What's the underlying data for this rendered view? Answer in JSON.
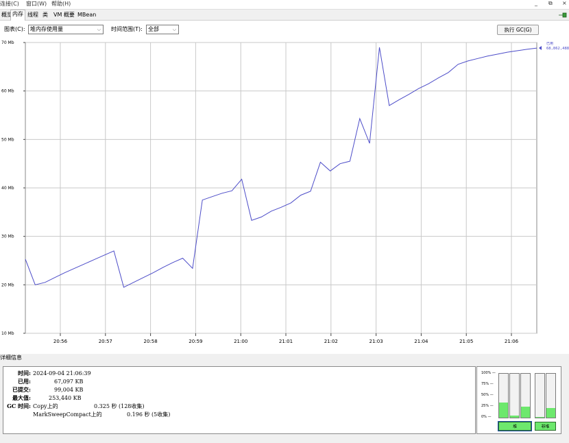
{
  "menubar": {
    "items": [
      "连接(C)",
      "窗口(W)",
      "帮助(H)"
    ]
  },
  "tabs": [
    "概览",
    "内存",
    "线程",
    "类",
    "VM 概要",
    "MBean"
  ],
  "toolbar": {
    "chart_label": "图表(C):",
    "chart_value": "堆内存使用量",
    "range_label": "时间范围(T):",
    "range_value": "全部",
    "gc_button": "执行 GC(G)"
  },
  "chart_data": {
    "type": "line",
    "x": [
      20.917,
      20.92,
      20.94,
      20.96,
      20.98,
      21.0,
      21.02,
      21.04,
      21.06,
      21.08,
      21.1,
      21.12,
      21.14,
      21.16,
      21.18,
      21.2,
      21.22,
      21.24,
      21.26,
      21.28,
      21.3,
      21.32,
      21.34,
      21.36,
      21.38,
      21.4,
      21.42,
      21.44,
      21.46,
      21.48,
      21.5,
      21.52,
      21.54,
      21.56,
      21.58,
      21.6,
      21.62,
      21.64,
      21.66,
      21.68,
      21.7,
      21.72,
      21.74,
      21.76,
      21.78,
      21.8,
      21.82,
      21.84,
      21.86,
      21.88,
      21.9,
      21.92,
      21.94,
      21.96,
      21.98,
      22.0,
      22.02,
      22.04,
      22.06,
      22.08,
      22.1,
      22.12,
      22.14,
      22.16,
      22.18,
      22.2,
      22.22,
      22.24,
      22.26,
      22.28,
      22.3,
      22.32,
      22.34,
      22.36,
      22.38,
      22.4,
      22.42,
      22.44,
      22.46,
      22.48,
      22.5,
      22.52,
      22.54,
      22.56,
      22.58,
      22.6,
      22.62,
      22.64,
      22.66,
      22.68,
      22.7,
      22.72,
      22.74,
      22.76,
      22.78,
      22.8,
      22.82,
      22.84,
      22.86,
      22.88,
      22.9,
      22.92,
      22.94,
      22.96,
      22.98,
      23.0,
      23.02,
      23.04,
      23.06,
      23.08,
      23.1
    ],
    "series": [
      {
        "name": "已用",
        "values": [
          25.3,
          20.0,
          20.5,
          21.5,
          22.5,
          23.4,
          24.3,
          25.2,
          26.1,
          27.0,
          19.5,
          20.5,
          21.5,
          22.5,
          23.6,
          24.6,
          25.5,
          23.4,
          37.5,
          38.2,
          38.9,
          39.4,
          41.8,
          33.3,
          34.0,
          35.2,
          36.0,
          36.9,
          38.5,
          39.3,
          45.3,
          43.5,
          45.0,
          45.5,
          54.3,
          49.2,
          69.0,
          57.0,
          58.2,
          59.3,
          60.5,
          61.5,
          62.7,
          63.8,
          65.5,
          66.2,
          66.7,
          67.2,
          67.6,
          68.0,
          68.3,
          68.6,
          68.86,
          68.86,
          68.86,
          68.86,
          68.86,
          68.86,
          68.86,
          68.86,
          68.86,
          68.86,
          68.86,
          68.86,
          68.86,
          68.86,
          68.86,
          68.86,
          68.86,
          68.86,
          68.86,
          68.86,
          68.86,
          68.86,
          68.86,
          68.86,
          68.86,
          68.86,
          68.86,
          68.86,
          68.86,
          68.86,
          68.86,
          68.86,
          68.86,
          68.86,
          68.86,
          68.86,
          68.86,
          68.86,
          68.86,
          68.86,
          68.86,
          68.86,
          68.86,
          68.86,
          68.86,
          68.86,
          68.86,
          68.86,
          68.86,
          68.86,
          68.86,
          68.86,
          68.86,
          68.86,
          68.86,
          68.86,
          68.86,
          68.86,
          68.86
        ]
      }
    ],
    "x_ticks": [
      "20:56",
      "20:57",
      "20:58",
      "20:59",
      "21:00",
      "21:01",
      "21:02",
      "21:03",
      "21:04",
      "21:05",
      "21:06"
    ],
    "y_ticks": [
      "10 Mb",
      "20 Mb",
      "30 Mb",
      "40 Mb",
      "50 Mb",
      "60 Mb",
      "70 Mb"
    ],
    "ylim": [
      10,
      70
    ],
    "legend": {
      "label": "已用",
      "value": "68,862,488"
    },
    "line_color": "#4b4bc8",
    "grid": true
  },
  "details": {
    "header": "详细信息",
    "rows": [
      {
        "label": "时间:",
        "value": "2024-09-04 21:06:39"
      },
      {
        "label": "已用:",
        "value": "67,097 KB"
      },
      {
        "label": "已提交:",
        "value": "99,004 KB"
      },
      {
        "label": "最大值:",
        "value": "253,440 KB"
      }
    ],
    "gc_label": "GC 时间:",
    "gc_rows": [
      {
        "name": "Copy上的",
        "value": "0.325 秒 (128收集)"
      },
      {
        "name": "MarkSweepCompact上的",
        "value": "0.196 秒 (5收集)"
      }
    ]
  },
  "gauges": {
    "ticks": [
      "100% —",
      "75% —",
      "50% —",
      "25% —",
      "0% —"
    ],
    "heap_bars": [
      0.35,
      0.05,
      0.25
    ],
    "nonheap_bars": [
      0.02,
      0.22
    ],
    "heap_label": "堆",
    "nonheap_label": "非堆",
    "fill_color": "#6de86d"
  }
}
